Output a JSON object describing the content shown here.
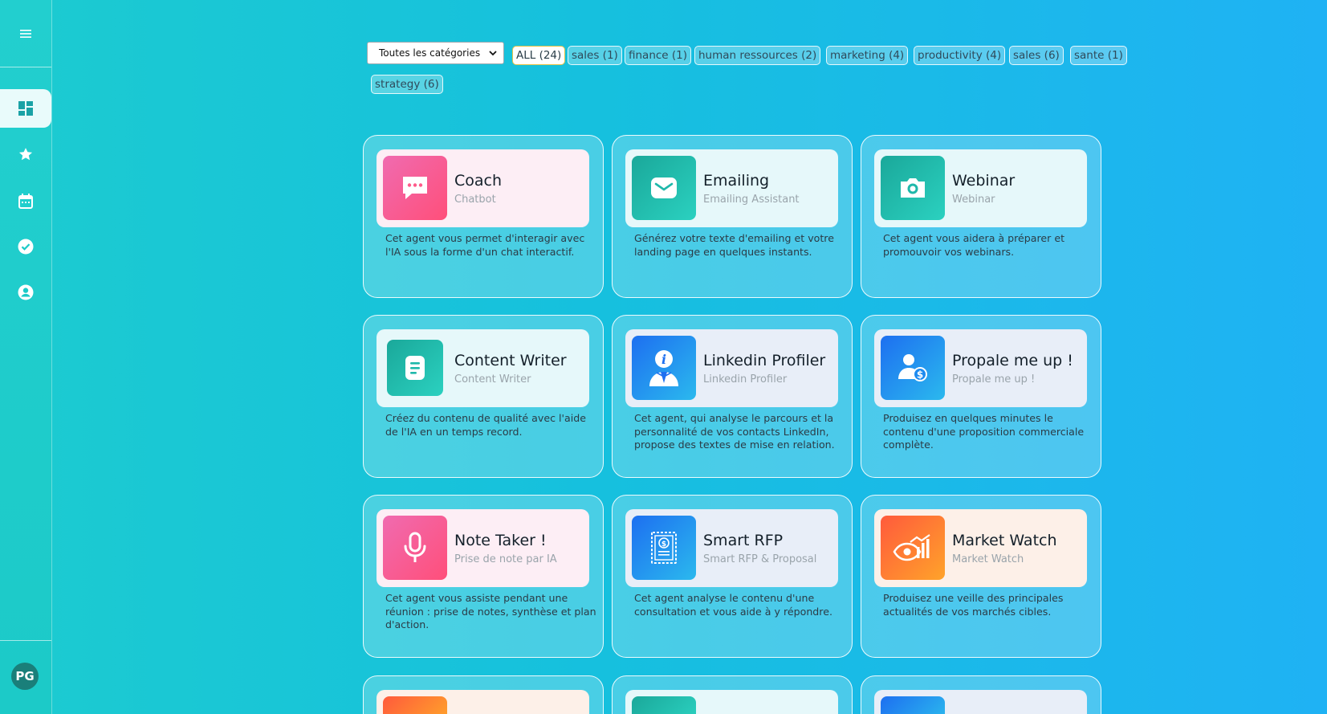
{
  "sidebar": {
    "menu_icon": "hamburger-icon",
    "items": [
      {
        "icon": "dashboard-icon",
        "active": true
      },
      {
        "icon": "star-icon",
        "active": false
      },
      {
        "icon": "calendar-icon",
        "active": false
      },
      {
        "icon": "check-circle-icon",
        "active": false
      },
      {
        "icon": "account-circle-icon",
        "active": false
      }
    ],
    "avatar_initials": "PG"
  },
  "filters": {
    "select_value": "Toutes les catégories",
    "chips": [
      {
        "label": "ALL (24)",
        "active": true
      },
      {
        "label": "sales (1)",
        "active": false
      },
      {
        "label": "finance (1)",
        "active": false
      },
      {
        "label": "human ressources (2)",
        "active": false
      },
      {
        "label": "marketing (4)",
        "active": false
      },
      {
        "label": "productivity (4)",
        "active": false
      },
      {
        "label": "sales (6)",
        "active": false
      },
      {
        "label": "sante (1)",
        "active": false
      },
      {
        "label": "strategy (6)",
        "active": false
      }
    ]
  },
  "cards": [
    {
      "title": "Coach",
      "subtitle": "Chatbot",
      "description": "Cet agent vous permet d'interagir avec l'IA sous la forme d'un chat interactif.",
      "icon": "chat-bubble-icon",
      "theme": "pink"
    },
    {
      "title": "Emailing",
      "subtitle": "Emailing Assistant",
      "description": "Générez votre texte d'emailing et votre landing page en quelques instants.",
      "icon": "mail-icon",
      "theme": "teal"
    },
    {
      "title": "Webinar",
      "subtitle": "Webinar",
      "description": "Cet agent vous aidera à préparer et promouvoir vos webinars.",
      "icon": "camera-icon",
      "theme": "teal"
    },
    {
      "title": "Content Writer",
      "subtitle": "Content Writer",
      "description": "Créez du contenu de qualité avec l'aide de l'IA en un temps record.",
      "icon": "document-icon",
      "theme": "teal"
    },
    {
      "title": "Linkedin Profiler",
      "subtitle": "Linkedin Profiler",
      "description": "Cet agent, qui analyse le parcours et la personnalité de vos contacts LinkedIn, propose des textes de mise en relation.",
      "icon": "profile-info-icon",
      "theme": "blue"
    },
    {
      "title": "Propale me up !",
      "subtitle": "Propale me up !",
      "description": "Produisez en quelques minutes le contenu d'une proposition commerciale complète.",
      "icon": "user-dollar-icon",
      "theme": "blue"
    },
    {
      "title": "Note Taker !",
      "subtitle": "Prise de note par IA",
      "description": "Cet agent vous assiste pendant une réunion : prise de notes, synthèse et plan d'action.",
      "icon": "microphone-icon",
      "theme": "pink"
    },
    {
      "title": "Smart RFP",
      "subtitle": "Smart RFP & Proposal",
      "description": "Cet agent analyse le contenu d'une consultation et vous aide à y répondre.",
      "icon": "dollar-document-icon",
      "theme": "blue"
    },
    {
      "title": "Market Watch",
      "subtitle": "Market Watch",
      "description": "Produisez une veille des principales actualités de vos marchés cibles.",
      "icon": "eye-chart-icon",
      "theme": "orange"
    }
  ],
  "partial_cards": [
    {
      "theme": "orange"
    },
    {
      "theme": "teal"
    },
    {
      "theme": "blue"
    }
  ]
}
